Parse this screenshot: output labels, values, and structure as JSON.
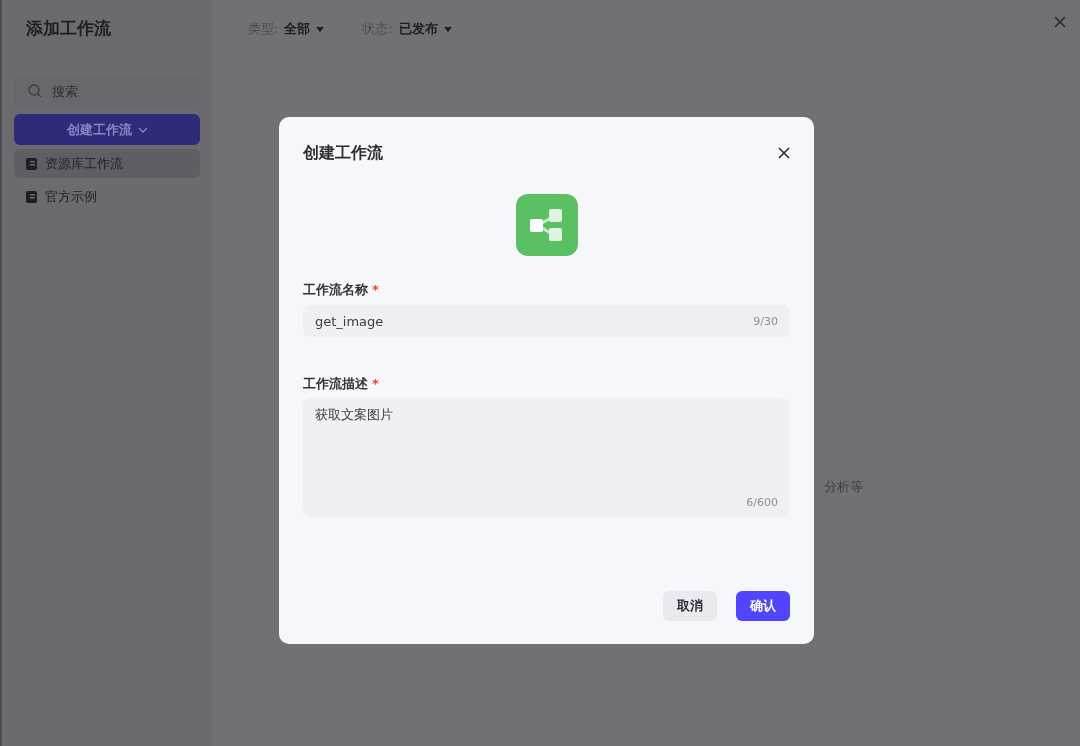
{
  "sidebar": {
    "title": "添加工作流",
    "search": {
      "placeholder": "搜索"
    },
    "create_button": "创建工作流",
    "items": [
      {
        "label": "资源库工作流",
        "selected": true
      },
      {
        "label": "官方示例",
        "selected": false
      }
    ]
  },
  "filters": [
    {
      "label": "类型:",
      "value": "全部"
    },
    {
      "label": "状态:",
      "value": "已发布"
    }
  ],
  "background_text": "分析等",
  "dialog": {
    "title": "创建工作流",
    "fields": [
      {
        "kind": "input",
        "label": "工作流名称",
        "required_mark": "*",
        "value": "get_image",
        "count": "9/30"
      },
      {
        "kind": "textarea",
        "label": "工作流描述",
        "required_mark": "*",
        "value": "获取文案图片",
        "count": "6/600"
      }
    ],
    "buttons": [
      {
        "label": "取消",
        "primary": false
      },
      {
        "label": "确认",
        "primary": true
      }
    ]
  }
}
